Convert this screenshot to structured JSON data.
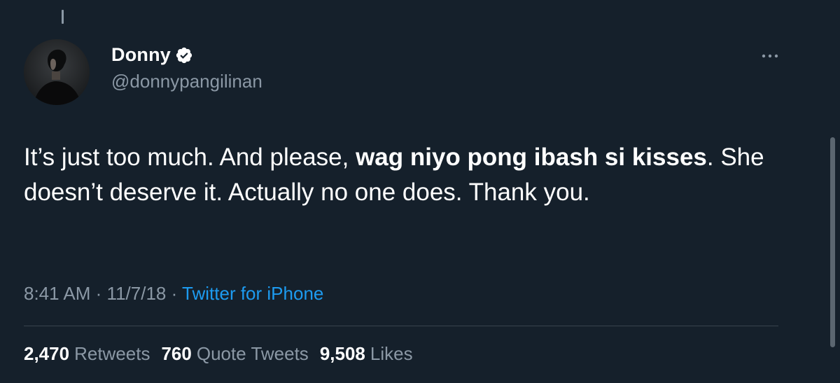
{
  "tweet": {
    "author": {
      "display_name": "Donny",
      "handle": "@donnypangilinan",
      "verified_icon": "verified-badge-icon"
    },
    "text_parts": [
      {
        "text": "It’s just too much. And please, ",
        "bold": false
      },
      {
        "text": "wag niyo pong ibash si kisses",
        "bold": true
      },
      {
        "text": ". She doesn’t deserve it. Actually no one does. Thank you.",
        "bold": false
      }
    ],
    "time": "8:41 AM",
    "date": "11/7/18",
    "separator": "·",
    "source": "Twitter for iPhone",
    "stats": {
      "retweets_count": "2,470",
      "retweets_label": "Retweets",
      "quotes_count": "760",
      "quotes_label": "Quote Tweets",
      "likes_count": "9,508",
      "likes_label": "Likes"
    }
  },
  "colors": {
    "background": "#15202b",
    "text_primary": "#ffffff",
    "text_secondary": "#8b98a5",
    "link": "#1d9bf0",
    "divider": "#38444d"
  }
}
